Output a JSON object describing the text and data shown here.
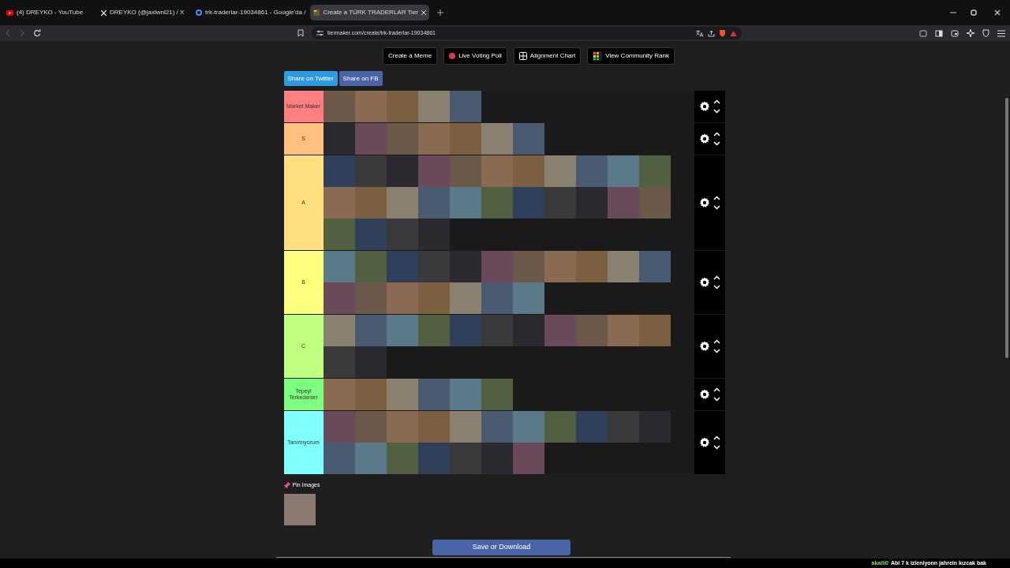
{
  "browser": {
    "tabs": [
      {
        "title": "(4) DREYKO - YouTube",
        "kind": "youtube",
        "selected": false
      },
      {
        "title": "DREYKO (@jaxlwnl21) / X",
        "kind": "x",
        "selected": false
      },
      {
        "title": "trk-traderlar-19034861 - Google'da /",
        "kind": "google",
        "selected": false
      },
      {
        "title": "Create a TÜRK TRADERLAR Tier",
        "kind": "tiermaker",
        "selected": true
      }
    ],
    "url": "tiermaker.com/create/trk-traderlar-19034861"
  },
  "top_buttons": [
    {
      "label": "Create a Meme",
      "kind": "plain"
    },
    {
      "label": "Live Voting Poll",
      "kind": "dot"
    },
    {
      "label": "Alignment Chart",
      "kind": "grid"
    },
    {
      "label": "View Community Rank",
      "kind": "squares"
    }
  ],
  "share_buttons": [
    {
      "label": "Share on Twitter",
      "kind": "twitter"
    },
    {
      "label": "Share on FB",
      "kind": "facebook"
    }
  ],
  "tiers": [
    {
      "label": "Market Maker",
      "color": "#ff7f7f",
      "images": [
        {
          "kind": "photo"
        },
        {
          "kind": "photo"
        },
        {
          "kind": "photo"
        },
        {
          "kind": "photo"
        },
        {
          "kind": "photo"
        }
      ]
    },
    {
      "label": "S",
      "color": "#ffbf7f",
      "images": [
        {
          "kind": "photo"
        },
        {
          "kind": "photo"
        },
        {
          "kind": "photo"
        },
        {
          "kind": "photo"
        },
        {
          "kind": "photo"
        },
        {
          "kind": "photo"
        },
        {
          "kind": "photo"
        }
      ]
    },
    {
      "label": "A",
      "color": "#ffdf7f",
      "images": [
        {
          "kind": "photo"
        },
        {
          "kind": "photo"
        },
        {
          "kind": "photo"
        },
        {
          "kind": "photo"
        },
        {
          "kind": "photo"
        },
        {
          "kind": "photo"
        },
        {
          "kind": "photo"
        },
        {
          "kind": "photo"
        },
        {
          "kind": "photo"
        },
        {
          "kind": "photo"
        },
        {
          "kind": "photo"
        },
        {
          "kind": "photo"
        },
        {
          "kind": "photo"
        },
        {
          "kind": "photo"
        },
        {
          "kind": "photo"
        },
        {
          "kind": "photo"
        },
        {
          "kind": "photo"
        },
        {
          "kind": "photo"
        },
        {
          "kind": "photo"
        },
        {
          "kind": "photo"
        },
        {
          "kind": "photo"
        },
        {
          "kind": "photo"
        },
        {
          "kind": "photo"
        },
        {
          "kind": "photo"
        },
        {
          "kind": "photo"
        },
        {
          "kind": "photo"
        }
      ]
    },
    {
      "label": "B",
      "color": "#ffff7f",
      "images": [
        {
          "kind": "photo"
        },
        {
          "kind": "photo"
        },
        {
          "kind": "photo"
        },
        {
          "kind": "photo"
        },
        {
          "kind": "photo"
        },
        {
          "kind": "photo"
        },
        {
          "kind": "photo"
        },
        {
          "kind": "photo"
        },
        {
          "kind": "photo"
        },
        {
          "kind": "photo"
        },
        {
          "kind": "photo"
        },
        {
          "kind": "photo"
        },
        {
          "kind": "photo"
        },
        {
          "kind": "photo"
        },
        {
          "kind": "photo"
        },
        {
          "kind": "photo"
        },
        {
          "kind": "photo"
        },
        {
          "kind": "photo"
        }
      ]
    },
    {
      "label": "C",
      "color": "#bfff7f",
      "images": [
        {
          "kind": "photo"
        },
        {
          "kind": "photo"
        },
        {
          "kind": "photo"
        },
        {
          "kind": "photo"
        },
        {
          "kind": "photo"
        },
        {
          "kind": "photo"
        },
        {
          "kind": "photo"
        },
        {
          "kind": "photo"
        },
        {
          "kind": "photo"
        },
        {
          "kind": "photo"
        },
        {
          "kind": "photo"
        },
        {
          "kind": "photo"
        },
        {
          "kind": "photo"
        }
      ]
    },
    {
      "label": "Tepeyi Terkedenler",
      "color": "#7fff7f",
      "images": [
        {
          "kind": "photo"
        },
        {
          "kind": "photo"
        },
        {
          "kind": "photo"
        },
        {
          "kind": "photo"
        },
        {
          "kind": "photo"
        },
        {
          "kind": "photo"
        }
      ]
    },
    {
      "label": "Tanımıyorum",
      "color": "#7fffff",
      "images": [
        {
          "kind": "photo"
        },
        {
          "kind": "photo"
        },
        {
          "kind": "photo"
        },
        {
          "kind": "photo"
        },
        {
          "kind": "photo"
        },
        {
          "kind": "photo"
        },
        {
          "kind": "photo"
        },
        {
          "kind": "photo"
        },
        {
          "kind": "photo"
        },
        {
          "kind": "photo"
        },
        {
          "kind": "photo"
        },
        {
          "kind": "photo"
        },
        {
          "kind": "photo"
        },
        {
          "kind": "photo"
        },
        {
          "kind": "photo"
        },
        {
          "kind": "photo"
        },
        {
          "kind": "photo"
        },
        {
          "kind": "photo"
        }
      ]
    }
  ],
  "pin_images": {
    "label": "Pin Images"
  },
  "save_button": "Save or Download",
  "chat": {
    "user": "akalli0",
    "message": "Abi 7 k izleniyonn jahrein kızcak bak"
  }
}
